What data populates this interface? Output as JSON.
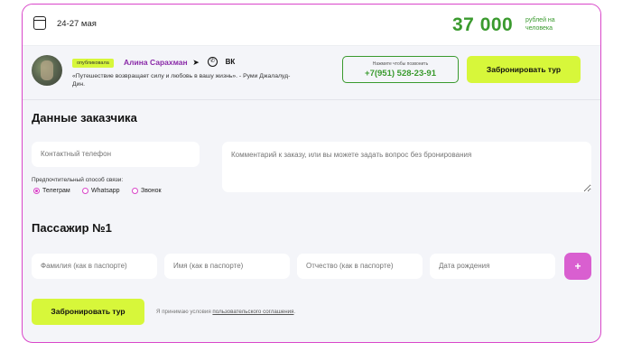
{
  "header": {
    "dates": "24-27 мая",
    "price": "37 000",
    "price_sub": "рублей на человека"
  },
  "author": {
    "badge": "опубликовала",
    "name": "Алина Сарахман",
    "quote": "«Путешествие возвращает силу и любовь в вашу жизнь». - Руми Джалалуд-Дин.",
    "icons": [
      "telegram-icon",
      "whatsapp-icon",
      "vk-icon"
    ],
    "vk_glyph": "ВК",
    "tg_glyph": "➤",
    "wa_glyph": "✆"
  },
  "call": {
    "hint": "Нажмите чтобы позвонить",
    "phone": "+7(951) 528-23-91"
  },
  "book_label": "Забронировать тур",
  "customer": {
    "title": "Данные заказчика",
    "phone_placeholder": "Контактный телефон",
    "comment_placeholder": "Комментарий к заказу, или вы можете задать вопрос без бронирования",
    "pref_label": "Предпочтительный способ связи:",
    "options": [
      {
        "label": "Телеграм",
        "selected": true
      },
      {
        "label": "Whatsapp",
        "selected": false
      },
      {
        "label": "Звонок",
        "selected": false
      }
    ]
  },
  "passenger": {
    "title": "Пассажир №1",
    "surname_placeholder": "Фамилия (как в паспорте)",
    "name_placeholder": "Имя (как в паспорте)",
    "patronymic_placeholder": "Отчество (как в паспорте)",
    "birth_placeholder": "Дата рождения",
    "add_label": "+"
  },
  "footer": {
    "book_label": "Забронировать тур",
    "agree_text": "Я принимаю условия ",
    "agree_link": "пользовательского соглашения",
    "agree_end": "."
  },
  "colors": {
    "accent_green": "#3a9a2e",
    "lime": "#d7f73a",
    "magenta": "#d946c9"
  }
}
